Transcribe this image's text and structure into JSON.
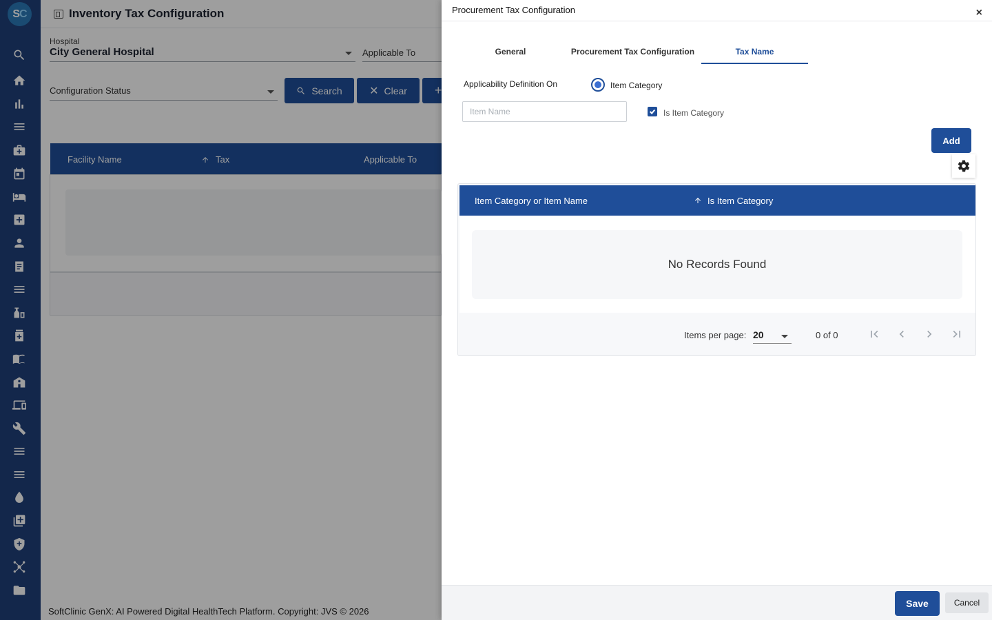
{
  "app": {
    "logo_letters": [
      "S",
      "C"
    ],
    "page_title": "Inventory Tax Configuration"
  },
  "sidebar": {
    "icons": [
      "search-icon",
      "home-icon",
      "bar-chart-icon",
      "menu-icon",
      "medical-bag-icon",
      "calendar-icon",
      "bed-icon",
      "plus-box-icon",
      "person-icon",
      "document-icon",
      "list-icon",
      "pharmacy-icon",
      "medicine-box-icon",
      "book-icon",
      "building-icon",
      "devices-icon",
      "wrench-icon",
      "lines-icon",
      "menu-icon-2",
      "drop-icon",
      "add-library-icon",
      "shield-icon",
      "network-icon",
      "folder-icon"
    ]
  },
  "filters": {
    "hospital_label": "Hospital",
    "hospital_value": "City General Hospital",
    "applicable_to_label": "Applicable To",
    "config_status_label": "Configuration Status",
    "search_label": "Search",
    "clear_label": "Clear",
    "add_symbol": "+"
  },
  "bg_grid": {
    "columns": [
      "Facility Name",
      "Tax",
      "Applicable To"
    ]
  },
  "footer": {
    "text": "SoftClinic GenX: AI Powered Digital HealthTech Platform. Copyright: JVS © 2026"
  },
  "drawer": {
    "title": "Procurement Tax Configuration",
    "close_symbol": "×",
    "tabs": [
      {
        "label": "General",
        "active": false
      },
      {
        "label": "Procurement Tax Configuration",
        "active": false
      },
      {
        "label": "Tax Name",
        "active": true
      }
    ],
    "applicability_label": "Applicability Definition On",
    "radio_option": "Item Category",
    "item_name_placeholder": "Item Name",
    "is_item_category_label": "Is Item Category",
    "is_item_category_checked": true,
    "add_label": "Add",
    "table": {
      "columns": [
        "Item Category or Item Name",
        "Is Item Category"
      ],
      "empty_message": "No Records Found"
    },
    "paginator": {
      "items_per_page_label": "Items per page:",
      "items_per_page_value": "20",
      "range_label": "0 of 0"
    },
    "save_label": "Save",
    "cancel_label": "Cancel"
  },
  "colors": {
    "primary": "#1f4e99",
    "sidebar": "#1f3f7a"
  }
}
